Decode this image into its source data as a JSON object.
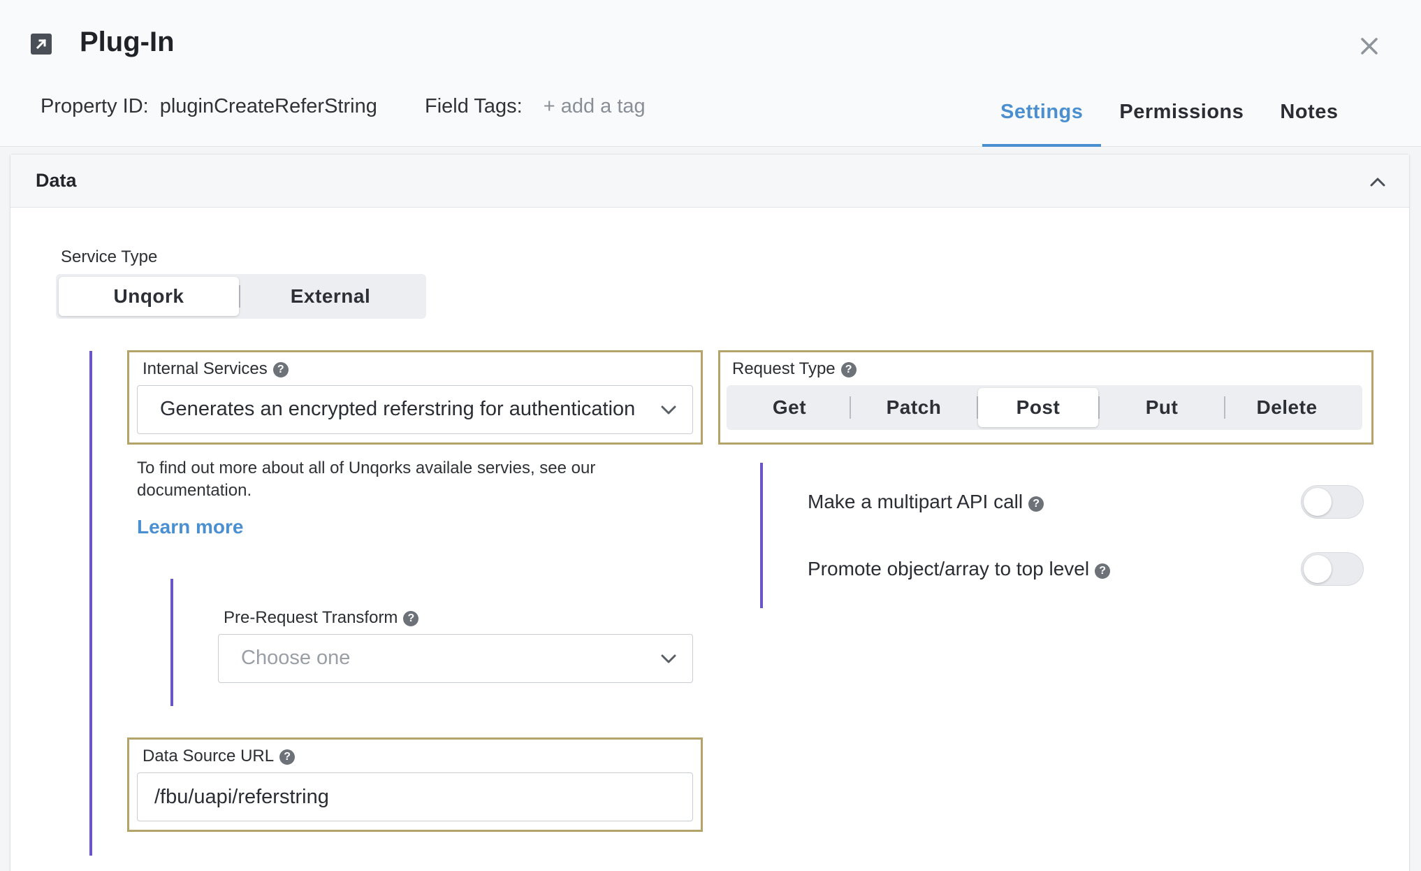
{
  "header": {
    "title": "Plug-In",
    "property_id_label": "Property ID:",
    "property_id_value": "pluginCreateReferString",
    "field_tags_label": "Field Tags:",
    "add_tag": "+ add a tag",
    "tabs": [
      {
        "label": "Settings",
        "active": true
      },
      {
        "label": "Permissions",
        "active": false
      },
      {
        "label": "Notes",
        "active": false
      }
    ]
  },
  "panel": {
    "title": "Data",
    "service_type": {
      "label": "Service Type",
      "options": [
        "Unqork",
        "External"
      ],
      "selected": "Unqork"
    },
    "internal_services": {
      "label": "Internal Services",
      "value": "Generates an encrypted referstring for authentication"
    },
    "info_text": "To find out more about all of Unqorks availale servies, see our documentation.",
    "learn_more": "Learn more",
    "pre_request_transform": {
      "label": "Pre-Request Transform",
      "placeholder": "Choose one"
    },
    "data_source_url": {
      "label": "Data Source URL",
      "value": "/fbu/uapi/referstring"
    },
    "request_type": {
      "label": "Request Type",
      "options": [
        "Get",
        "Patch",
        "Post",
        "Put",
        "Delete"
      ],
      "selected": "Post"
    },
    "toggles": [
      {
        "label": "Make a multipart API call",
        "on": false
      },
      {
        "label": "Promote object/array to top level",
        "on": false
      }
    ]
  },
  "colors": {
    "accent": "#4a8fd0",
    "highlight_border": "#b5a46a",
    "indent_line": "#6a55c9"
  }
}
